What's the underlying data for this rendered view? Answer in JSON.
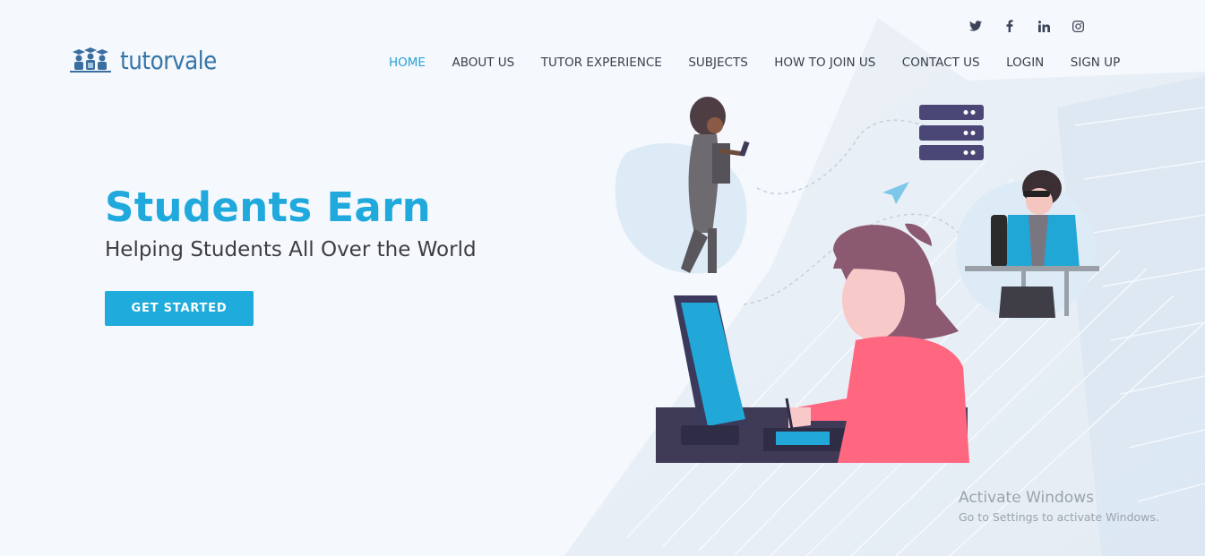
{
  "brand": {
    "name": "tutorvale",
    "logo_icon": "graduates-logo-icon"
  },
  "social": [
    {
      "icon": "twitter-icon",
      "glyph": "🐦"
    },
    {
      "icon": "facebook-icon",
      "glyph": "f"
    },
    {
      "icon": "linkedin-icon",
      "glyph": "in"
    },
    {
      "icon": "instagram-icon",
      "glyph": "◎"
    }
  ],
  "nav": {
    "items": [
      {
        "label": "HOME",
        "active": true
      },
      {
        "label": "ABOUT US"
      },
      {
        "label": "TUTOR EXPERIENCE"
      },
      {
        "label": "SUBJECTS"
      },
      {
        "label": "HOW TO JOIN US"
      },
      {
        "label": "CONTACT US"
      },
      {
        "label": "LOGIN"
      },
      {
        "label": "SIGN UP"
      }
    ]
  },
  "hero": {
    "title": "Students Earn",
    "subtitle": "Helping Students All Over the World",
    "cta_label": "GET STARTED"
  },
  "watermark": {
    "line1": "Activate Windows",
    "line2": "Go to Settings to activate Windows."
  },
  "colors": {
    "accent": "#1fa9dc",
    "text": "#3a3f4b",
    "background": "#f5f8fc"
  }
}
